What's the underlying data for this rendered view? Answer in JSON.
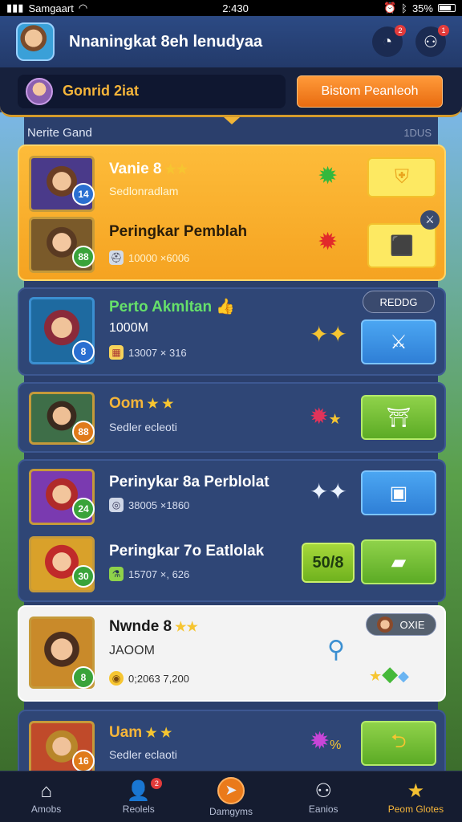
{
  "status_bar": {
    "carrier": "Samgaart",
    "time": "2:430",
    "battery": "35%"
  },
  "header": {
    "title": "Nnaningkat 8eh lenudyaa",
    "notif_badge": "2",
    "friends_badge": "1"
  },
  "profile": {
    "name": "Gonrid 2iat",
    "action_label": "Bistom Peanleoh"
  },
  "section": {
    "title": "Nerite Gand",
    "count": "1DUS"
  },
  "cards": [
    {
      "rows": [
        {
          "title": "Vanie 8",
          "stars": "★★",
          "sub": "Sedlonradlam",
          "level": "14"
        },
        {
          "title": "Peringkar Pemblah",
          "meta": "10000 ×6006",
          "level": "88"
        }
      ]
    },
    {
      "title": "Perto Akmltan",
      "value": "1000M",
      "meta": "13007 × 316",
      "level": "8",
      "tag": "REDDG"
    },
    {
      "title": "Oom",
      "stars": "★ ★",
      "sub": "Sedler ecleoti",
      "level": "88"
    },
    {
      "rows": [
        {
          "title": "Perinykar 8a Perblolat",
          "meta": "38005 ×1860",
          "level": "24"
        },
        {
          "title": "Peringkar 7o Eatlolak",
          "meta": "15707 ×, 626",
          "level": "30",
          "score": "50/8"
        }
      ]
    },
    {
      "title": "Nwnde 8",
      "stars": "★★",
      "value": "JAOOM",
      "meta": "0;2063 7,200",
      "level": "8",
      "tag": "OXIE"
    },
    {
      "title": "Uam",
      "stars": "★ ★",
      "sub": "Sedler eclaoti",
      "level": "16"
    }
  ],
  "nav": [
    {
      "label": "Amobs",
      "icon": "home-icon"
    },
    {
      "label": "Reolels",
      "icon": "user-icon",
      "badge": "2"
    },
    {
      "label": "Damgyms",
      "icon": "game-icon"
    },
    {
      "label": "Eanios",
      "icon": "group-icon"
    },
    {
      "label": "Peom Glotes",
      "icon": "star-icon"
    }
  ],
  "colors": {
    "accent": "#ea7a1a",
    "gold": "#f5a321",
    "panel": "#2f4676",
    "highlight": "#f5b53a"
  }
}
